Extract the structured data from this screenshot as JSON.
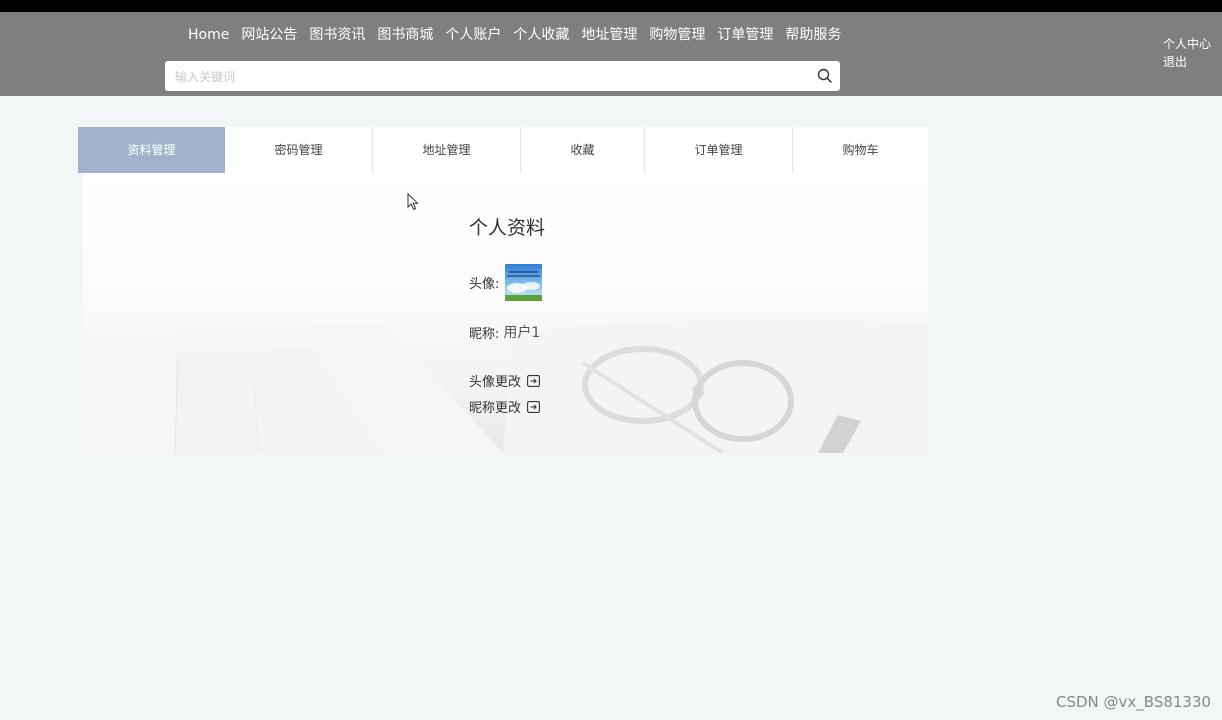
{
  "nav": {
    "items": [
      "Home",
      "网站公告",
      "图书资讯",
      "图书商城",
      "个人账户",
      "个人收藏",
      "地址管理",
      "购物管理",
      "订单管理",
      "帮助服务"
    ]
  },
  "search": {
    "placeholder": "输入关键词",
    "icon": "search-icon"
  },
  "user_links": {
    "center": "个人中心",
    "logout": "退出"
  },
  "tabs": [
    {
      "label": "资料管理",
      "active": true
    },
    {
      "label": "密码管理",
      "active": false
    },
    {
      "label": "地址管理",
      "active": false
    },
    {
      "label": "收藏",
      "active": false
    },
    {
      "label": "订单管理",
      "active": false
    },
    {
      "label": "购物车",
      "active": false
    }
  ],
  "profile": {
    "title": "个人资料",
    "avatar_label": "头像:",
    "nickname_label": "昵称:",
    "nickname_value": "用户1",
    "change_avatar": "头像更改",
    "change_nickname": "昵称更改"
  },
  "watermark": "CSDN @vx_BS81330",
  "colors": {
    "header": "#7f7f7f",
    "active_tab": "#a1b3cc",
    "page_bg": "#f2f6f7"
  }
}
